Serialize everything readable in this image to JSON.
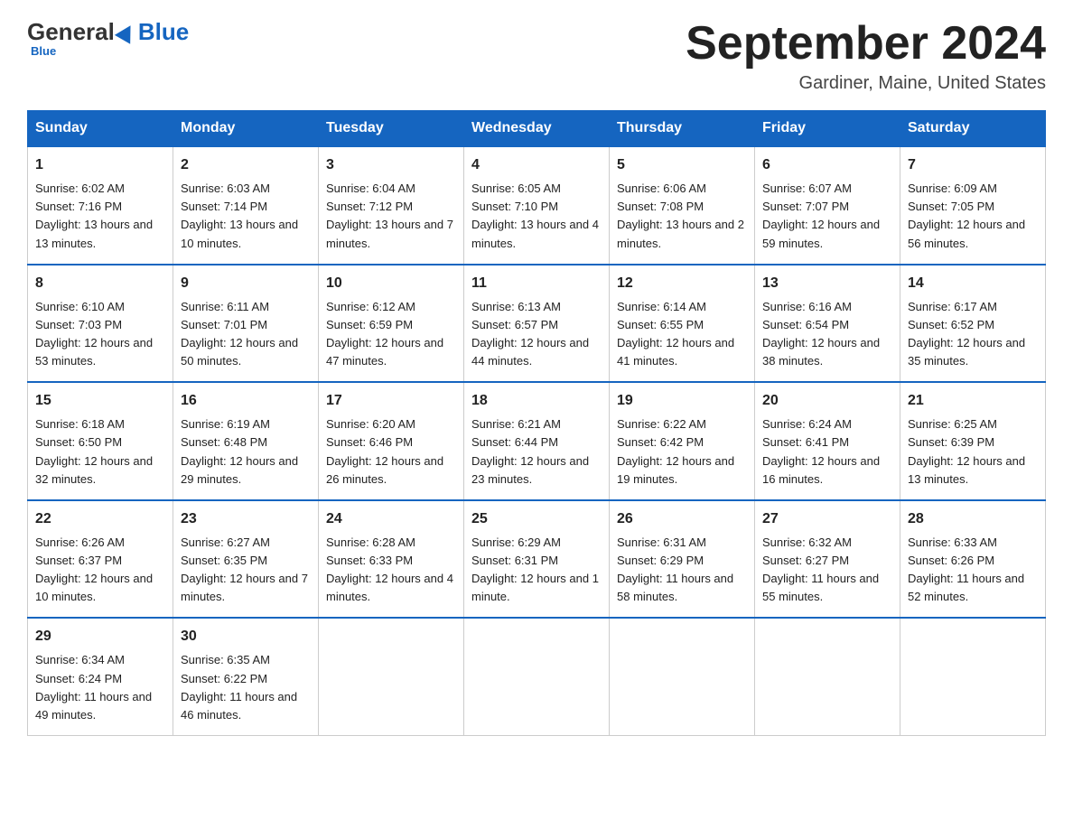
{
  "header": {
    "logo_general": "General",
    "logo_blue": "Blue",
    "month_title": "September 2024",
    "location": "Gardiner, Maine, United States"
  },
  "days_of_week": [
    "Sunday",
    "Monday",
    "Tuesday",
    "Wednesday",
    "Thursday",
    "Friday",
    "Saturday"
  ],
  "weeks": [
    [
      {
        "num": "1",
        "sunrise": "6:02 AM",
        "sunset": "7:16 PM",
        "daylight": "13 hours and 13 minutes."
      },
      {
        "num": "2",
        "sunrise": "6:03 AM",
        "sunset": "7:14 PM",
        "daylight": "13 hours and 10 minutes."
      },
      {
        "num": "3",
        "sunrise": "6:04 AM",
        "sunset": "7:12 PM",
        "daylight": "13 hours and 7 minutes."
      },
      {
        "num": "4",
        "sunrise": "6:05 AM",
        "sunset": "7:10 PM",
        "daylight": "13 hours and 4 minutes."
      },
      {
        "num": "5",
        "sunrise": "6:06 AM",
        "sunset": "7:08 PM",
        "daylight": "13 hours and 2 minutes."
      },
      {
        "num": "6",
        "sunrise": "6:07 AM",
        "sunset": "7:07 PM",
        "daylight": "12 hours and 59 minutes."
      },
      {
        "num": "7",
        "sunrise": "6:09 AM",
        "sunset": "7:05 PM",
        "daylight": "12 hours and 56 minutes."
      }
    ],
    [
      {
        "num": "8",
        "sunrise": "6:10 AM",
        "sunset": "7:03 PM",
        "daylight": "12 hours and 53 minutes."
      },
      {
        "num": "9",
        "sunrise": "6:11 AM",
        "sunset": "7:01 PM",
        "daylight": "12 hours and 50 minutes."
      },
      {
        "num": "10",
        "sunrise": "6:12 AM",
        "sunset": "6:59 PM",
        "daylight": "12 hours and 47 minutes."
      },
      {
        "num": "11",
        "sunrise": "6:13 AM",
        "sunset": "6:57 PM",
        "daylight": "12 hours and 44 minutes."
      },
      {
        "num": "12",
        "sunrise": "6:14 AM",
        "sunset": "6:55 PM",
        "daylight": "12 hours and 41 minutes."
      },
      {
        "num": "13",
        "sunrise": "6:16 AM",
        "sunset": "6:54 PM",
        "daylight": "12 hours and 38 minutes."
      },
      {
        "num": "14",
        "sunrise": "6:17 AM",
        "sunset": "6:52 PM",
        "daylight": "12 hours and 35 minutes."
      }
    ],
    [
      {
        "num": "15",
        "sunrise": "6:18 AM",
        "sunset": "6:50 PM",
        "daylight": "12 hours and 32 minutes."
      },
      {
        "num": "16",
        "sunrise": "6:19 AM",
        "sunset": "6:48 PM",
        "daylight": "12 hours and 29 minutes."
      },
      {
        "num": "17",
        "sunrise": "6:20 AM",
        "sunset": "6:46 PM",
        "daylight": "12 hours and 26 minutes."
      },
      {
        "num": "18",
        "sunrise": "6:21 AM",
        "sunset": "6:44 PM",
        "daylight": "12 hours and 23 minutes."
      },
      {
        "num": "19",
        "sunrise": "6:22 AM",
        "sunset": "6:42 PM",
        "daylight": "12 hours and 19 minutes."
      },
      {
        "num": "20",
        "sunrise": "6:24 AM",
        "sunset": "6:41 PM",
        "daylight": "12 hours and 16 minutes."
      },
      {
        "num": "21",
        "sunrise": "6:25 AM",
        "sunset": "6:39 PM",
        "daylight": "12 hours and 13 minutes."
      }
    ],
    [
      {
        "num": "22",
        "sunrise": "6:26 AM",
        "sunset": "6:37 PM",
        "daylight": "12 hours and 10 minutes."
      },
      {
        "num": "23",
        "sunrise": "6:27 AM",
        "sunset": "6:35 PM",
        "daylight": "12 hours and 7 minutes."
      },
      {
        "num": "24",
        "sunrise": "6:28 AM",
        "sunset": "6:33 PM",
        "daylight": "12 hours and 4 minutes."
      },
      {
        "num": "25",
        "sunrise": "6:29 AM",
        "sunset": "6:31 PM",
        "daylight": "12 hours and 1 minute."
      },
      {
        "num": "26",
        "sunrise": "6:31 AM",
        "sunset": "6:29 PM",
        "daylight": "11 hours and 58 minutes."
      },
      {
        "num": "27",
        "sunrise": "6:32 AM",
        "sunset": "6:27 PM",
        "daylight": "11 hours and 55 minutes."
      },
      {
        "num": "28",
        "sunrise": "6:33 AM",
        "sunset": "6:26 PM",
        "daylight": "11 hours and 52 minutes."
      }
    ],
    [
      {
        "num": "29",
        "sunrise": "6:34 AM",
        "sunset": "6:24 PM",
        "daylight": "11 hours and 49 minutes."
      },
      {
        "num": "30",
        "sunrise": "6:35 AM",
        "sunset": "6:22 PM",
        "daylight": "11 hours and 46 minutes."
      },
      null,
      null,
      null,
      null,
      null
    ]
  ]
}
